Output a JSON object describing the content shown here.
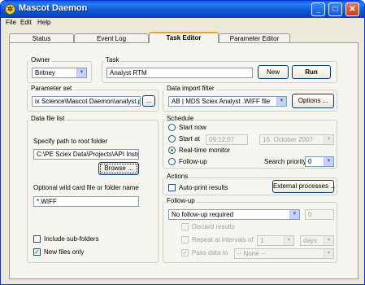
{
  "window": {
    "title": "Mascot Daemon",
    "icon": "daemon-icon",
    "controls": {
      "minimize": "_",
      "maximize": "□",
      "close": "✕"
    }
  },
  "menu": [
    "File",
    "Edit",
    "Help"
  ],
  "tabs": [
    "Status",
    "Event Log",
    "Task Editor",
    "Parameter Editor"
  ],
  "active_tab": "Task Editor",
  "owner": {
    "label": "Owner",
    "value": "Britney"
  },
  "task": {
    "label": "Task",
    "name": "Analyst RTM",
    "new_label": "New",
    "run_label": "Run"
  },
  "parameter_set": {
    "label": "Parameter set",
    "path": "ix Science\\Mascot Daemon\\analyst.par",
    "browse_label": "..."
  },
  "data_import_filter": {
    "label": "Data import filter",
    "value": "AB | MDS Sciex Analyst .WIFF file",
    "options_label": "Options ..."
  },
  "data_file_list": {
    "label": "Data file list",
    "root_label": "Specify path to root folder",
    "root_path": "C:\\PE Sciex Data\\Projects\\API Instrum",
    "browse_label": "Browse ...",
    "wildcard_label": "Optional wild card file or folder name",
    "wildcard_value": "*.WIFF",
    "include_subfolders": {
      "label": "Include sub-folders",
      "checked": false
    },
    "new_files_only": {
      "label": "New files only",
      "checked": true
    }
  },
  "schedule": {
    "label": "Schedule",
    "options": [
      "Start now",
      "Start at",
      "Real-time monitor",
      "Follow-up"
    ],
    "selected": "Real-time monitor",
    "start_time": "09:12:07",
    "start_date": "16. October 2007",
    "priority_label": "Search priority",
    "priority_value": "0"
  },
  "actions": {
    "label": "Actions",
    "auto_print": {
      "label": "Auto-print results",
      "checked": false
    },
    "external_label": "External processes ..."
  },
  "follow_up": {
    "label": "Follow-up",
    "mode": "No follow-up required",
    "count": "0",
    "discard": {
      "label": "Discard results",
      "checked": false
    },
    "repeat": {
      "label": "Repeat at intervals of",
      "checked": false,
      "interval": "1",
      "unit": "days"
    },
    "pass_data": {
      "label": "Pass data to",
      "checked": true,
      "target": "-- None --"
    }
  },
  "colors": {
    "titlebar": "#0a5fe8",
    "window_face": "#ece9d8",
    "tab_accent": "#e6a32c",
    "radio_dot": "#21a121"
  }
}
